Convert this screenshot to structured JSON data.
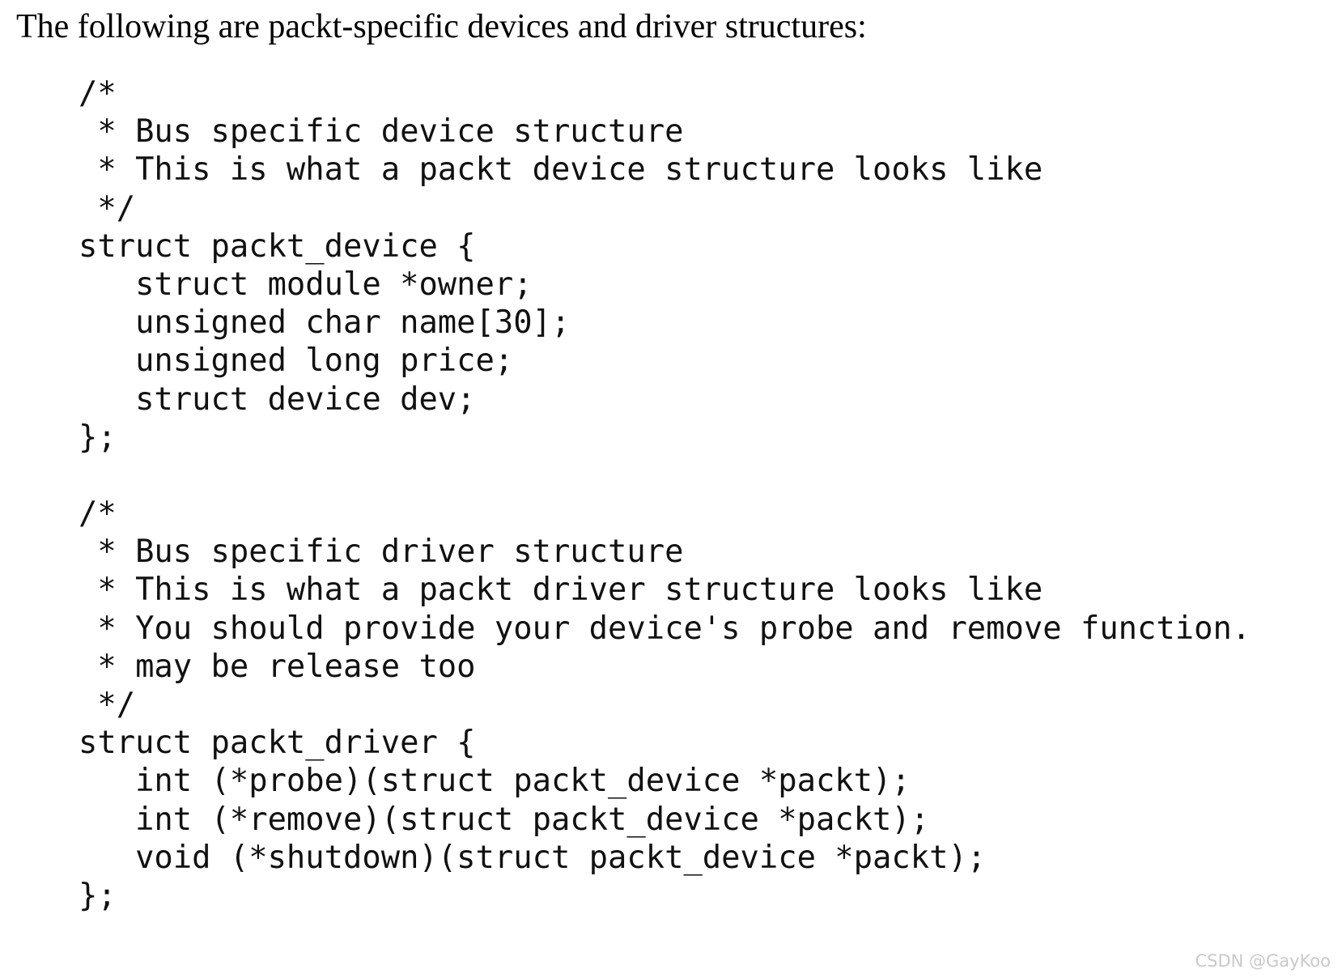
{
  "document": {
    "heading": "The following are packt-specific devices and driver structures:",
    "background_color": "#ffffff",
    "text_color": "#111111"
  },
  "code": {
    "language": "c",
    "lines": [
      "/*",
      " * Bus specific device structure",
      " * This is what a packt device structure looks like",
      " */",
      "struct packt_device {",
      "   struct module *owner;",
      "   unsigned char name[30];",
      "   unsigned long price;",
      "   struct device dev;",
      "};",
      "",
      "/*",
      " * Bus specific driver structure",
      " * This is what a packt driver structure looks like",
      " * You should provide your device's probe and remove function.",
      " * may be release too",
      " */",
      "struct packt_driver {",
      "   int (*probe)(struct packt_device *packt);",
      "   int (*remove)(struct packt_device *packt);",
      "   void (*shutdown)(struct packt_device *packt);",
      "};"
    ]
  },
  "watermark": {
    "text": "CSDN @GayKoo",
    "color": "#c9c9c9"
  }
}
